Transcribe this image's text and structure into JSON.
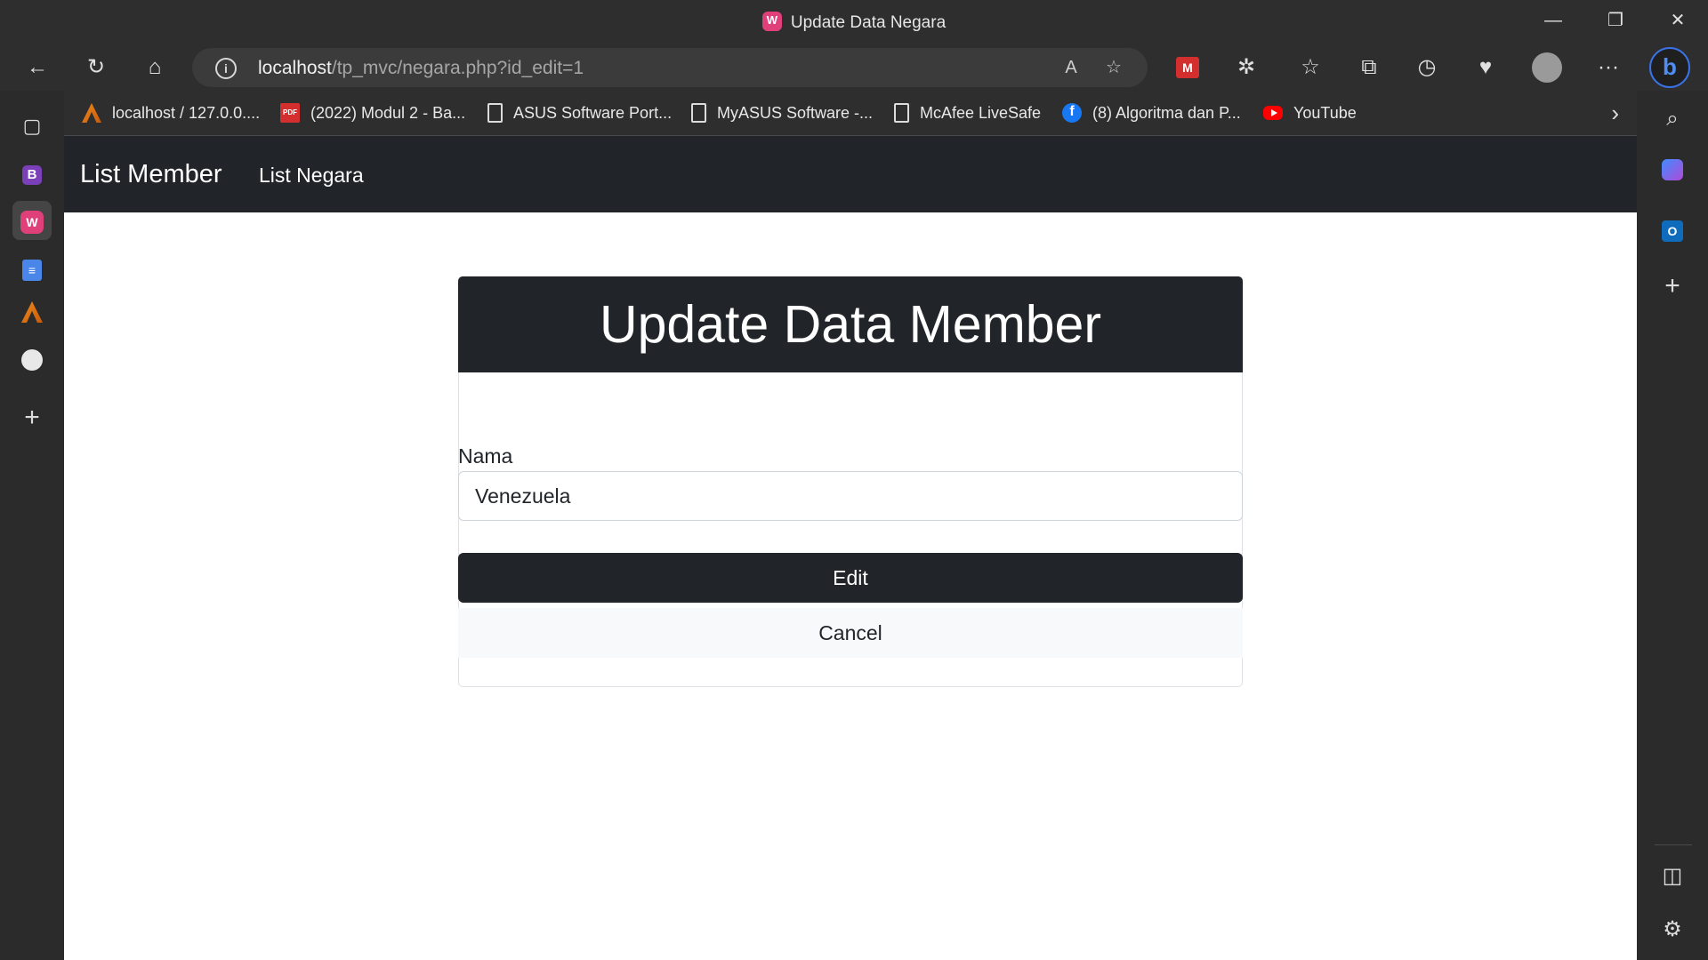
{
  "window": {
    "title": "Update Data Negara",
    "minimize": "—",
    "restore": "❐",
    "close": "✕"
  },
  "toolbar": {
    "back_icon": "←",
    "refresh_icon": "↻",
    "home_icon": "⌂",
    "url_host": "localhost",
    "url_path": "/tp_mvc/negara.php?id_edit=1",
    "read_aloud_icon": "A",
    "favorite_add_icon": "☆",
    "extensions_icon": "✲",
    "favorites_icon": "☆",
    "collections_icon": "⧉",
    "history_icon": "◷",
    "health_icon": "♥",
    "more_icon": "···",
    "bing_label": "b"
  },
  "bookmarks": [
    {
      "label": "localhost / 127.0.0....",
      "icon": "xampp-icon"
    },
    {
      "label": "(2022) Modul 2 - Ba...",
      "icon": "pdf-icon"
    },
    {
      "label": "ASUS Software Port...",
      "icon": "page-icon"
    },
    {
      "label": "MyASUS Software -...",
      "icon": "page-icon"
    },
    {
      "label": "McAfee LiveSafe",
      "icon": "page-icon"
    },
    {
      "label": "(8) Algoritma dan P...",
      "icon": "facebook-icon"
    },
    {
      "label": "YouTube",
      "icon": "youtube-icon"
    }
  ],
  "bookmarks_more": "›",
  "left_sidebar": {
    "tabs_icon": "▢",
    "b_label": "B",
    "w_label": "W",
    "doc_icon": "≡",
    "add_icon": "+"
  },
  "right_sidebar": {
    "search_icon": "⌕",
    "outlook_label": "O",
    "add_icon": "+",
    "panel_icon": "◫",
    "settings_icon": "⚙"
  },
  "navbar": {
    "brand": "List Member",
    "link": "List Negara"
  },
  "form": {
    "heading": "Update Data Member",
    "nama_label": "Nama",
    "nama_value": "Venezuela",
    "edit_label": "Edit",
    "cancel_label": "Cancel"
  }
}
